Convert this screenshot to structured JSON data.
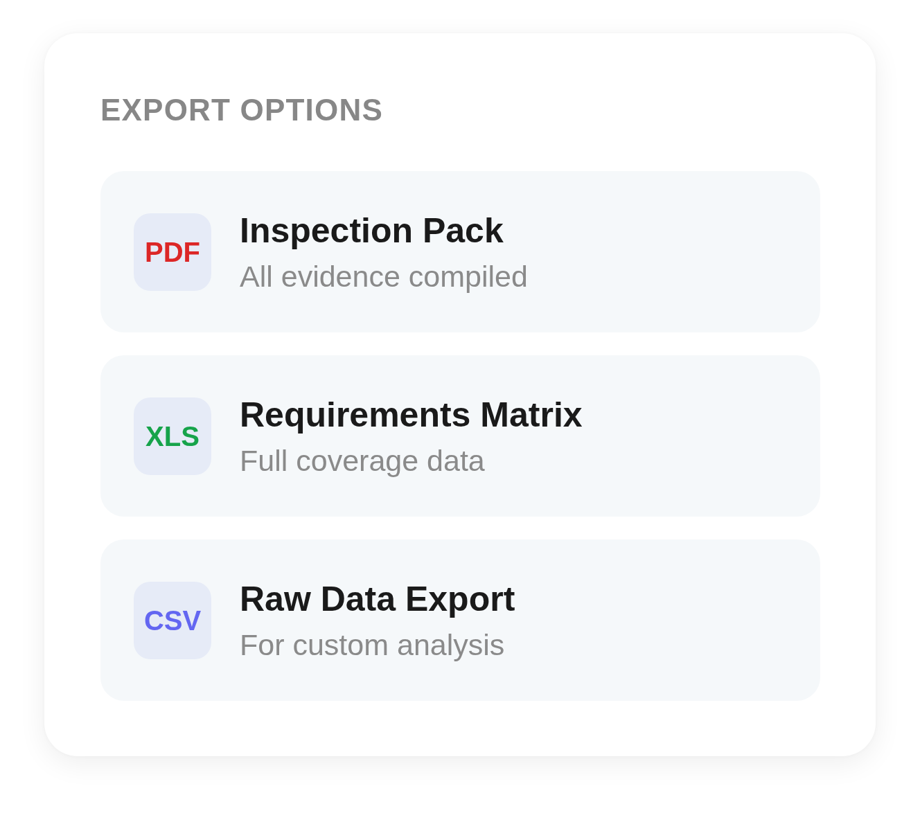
{
  "heading": "EXPORT OPTIONS",
  "options": [
    {
      "badge": "PDF",
      "color": "#dc2626",
      "title": "Inspection Pack",
      "subtitle": "All evidence compiled"
    },
    {
      "badge": "XLS",
      "color": "#16a34a",
      "title": "Requirements Matrix",
      "subtitle": "Full coverage data"
    },
    {
      "badge": "CSV",
      "color": "#6366f1",
      "title": "Raw Data Export",
      "subtitle": "For custom analysis"
    }
  ]
}
